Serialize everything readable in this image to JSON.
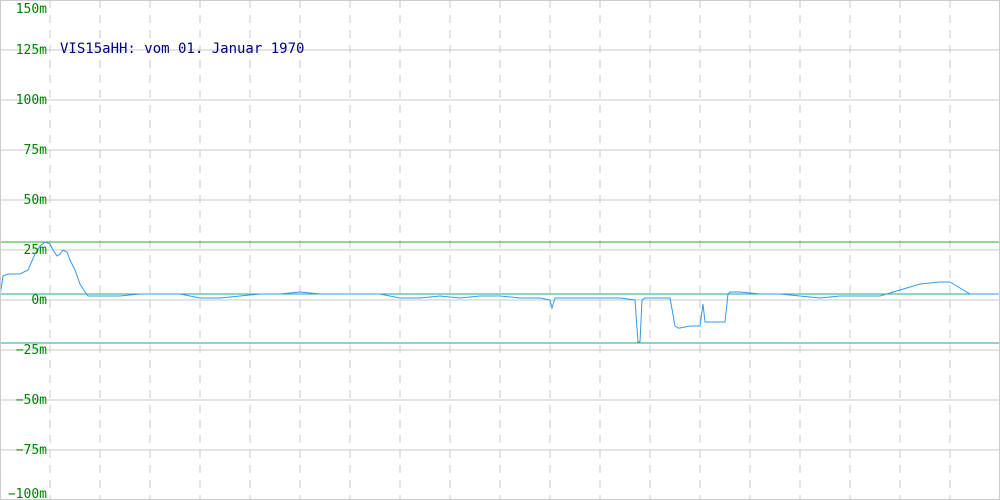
{
  "chart_data": {
    "type": "line",
    "title": "VIS15aHH: vom 01. Januar 1970",
    "ylim": [
      -100,
      150
    ],
    "xlim": [
      0,
      1000
    ],
    "grid": true,
    "y_ticks": [
      {
        "value": 150,
        "label": "150m"
      },
      {
        "value": 125,
        "label": "125m"
      },
      {
        "value": 100,
        "label": "100m"
      },
      {
        "value": 75,
        "label": "75m"
      },
      {
        "value": 50,
        "label": "50m"
      },
      {
        "value": 25,
        "label": "25m"
      },
      {
        "value": 0,
        "label": "0m"
      },
      {
        "value": -25,
        "label": "−25m"
      },
      {
        "value": -50,
        "label": "−50m"
      },
      {
        "value": -75,
        "label": "−75m"
      },
      {
        "value": -100,
        "label": "−100m"
      }
    ],
    "x_grid": [
      50,
      100,
      150,
      200,
      250,
      300,
      350,
      400,
      450,
      500,
      550,
      600,
      650,
      700,
      750,
      800,
      850,
      900,
      950
    ],
    "reference_lines": [
      {
        "value": 29,
        "color": "#33aa33"
      },
      {
        "value": 3,
        "color": "#22aa88"
      },
      {
        "value": -21.5,
        "color": "#22aa88"
      }
    ],
    "series": [
      {
        "color": "#3399ee",
        "x": [
          0,
          3,
          8,
          20,
          28,
          35,
          40,
          45,
          50,
          53,
          57,
          60,
          63,
          67,
          70,
          75,
          80,
          85,
          88,
          92,
          95,
          100,
          120,
          140,
          160,
          180,
          200,
          220,
          240,
          260,
          280,
          300,
          320,
          340,
          360,
          380,
          400,
          420,
          440,
          460,
          480,
          500,
          520,
          540,
          550,
          552,
          555,
          580,
          600,
          620,
          635,
          638,
          640,
          642,
          645,
          650,
          660,
          670,
          675,
          678,
          680,
          690,
          700,
          703,
          705,
          710,
          720,
          725,
          728,
          730,
          740,
          760,
          780,
          800,
          820,
          840,
          860,
          880,
          900,
          920,
          940,
          950,
          960,
          970,
          980,
          1000
        ],
        "y": [
          2,
          12,
          13,
          13,
          15,
          23,
          27,
          29,
          28,
          25,
          22,
          23,
          25,
          24,
          20,
          15,
          8,
          4,
          2,
          2,
          2,
          2,
          2,
          3,
          3,
          3,
          1,
          1,
          2,
          3,
          3,
          4,
          3,
          3,
          3,
          3,
          1,
          1,
          2,
          1,
          2,
          2,
          1,
          1,
          0,
          -4,
          1,
          1,
          1,
          1,
          0,
          -21,
          -21,
          0,
          1,
          1,
          1,
          1,
          -13,
          -14,
          -14,
          -13,
          -13,
          -2,
          -11,
          -11,
          -11,
          -11,
          3,
          4,
          4,
          3,
          3,
          2,
          1,
          2,
          2,
          2,
          5,
          8,
          9,
          9,
          6,
          3,
          3,
          3
        ]
      }
    ]
  }
}
